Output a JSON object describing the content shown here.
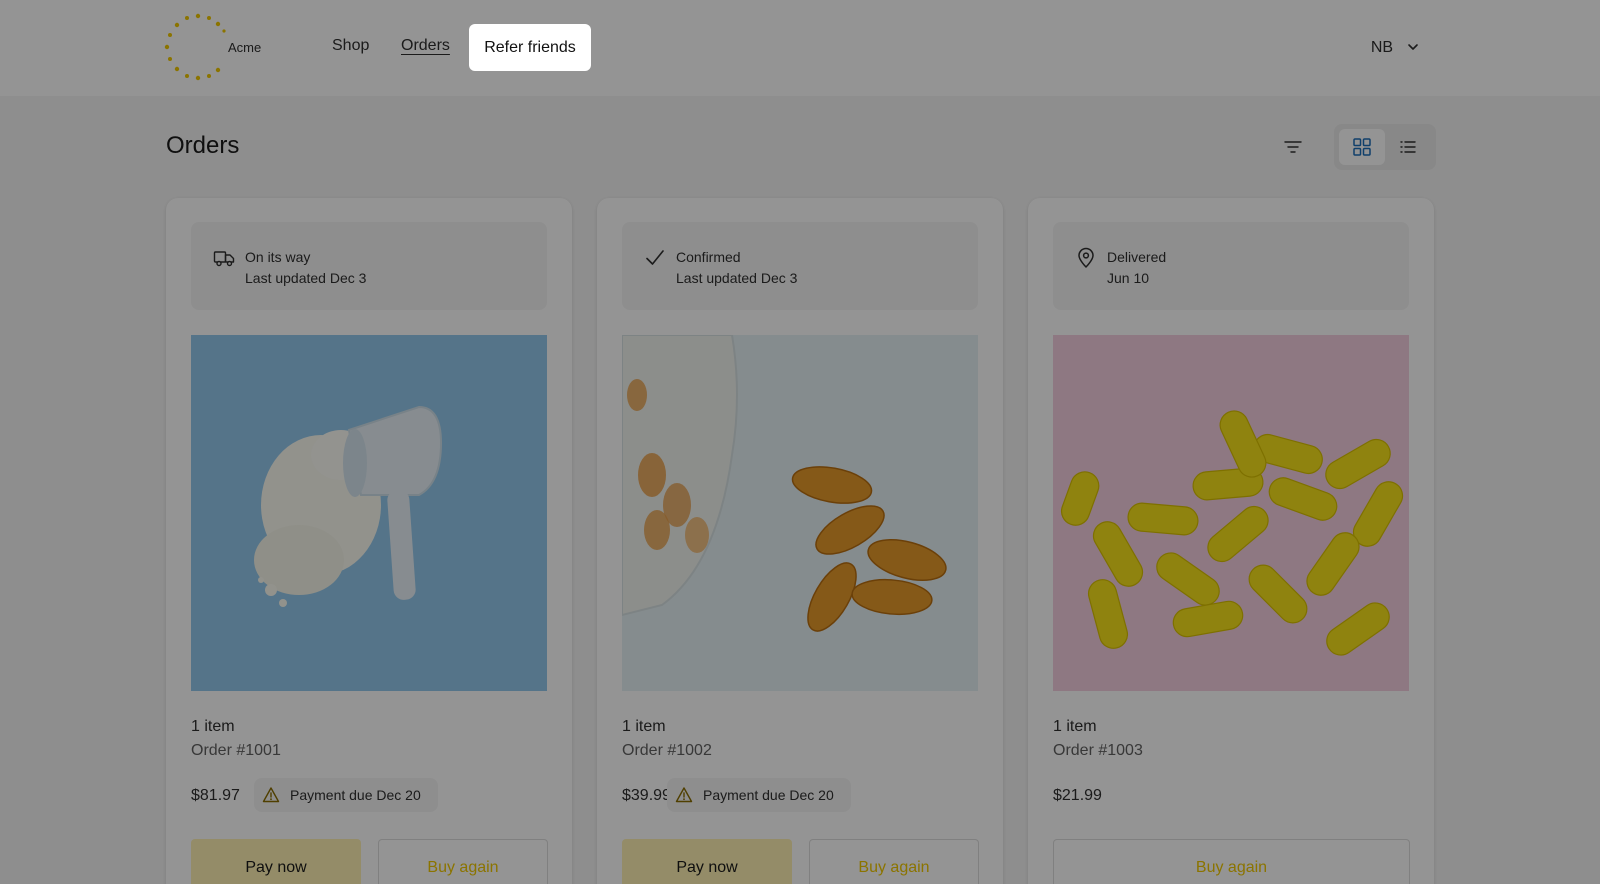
{
  "app": {
    "logo_text": "Acme"
  },
  "nav": {
    "shop": "Shop",
    "orders": "Orders",
    "refer": "Refer friends"
  },
  "user": {
    "initials": "NB"
  },
  "page": {
    "title": "Orders"
  },
  "colors": {
    "accent_yellow": "#f0c800",
    "pay_button": "#fff2b3",
    "overlay": "rgba(0,0,0,0.42)"
  },
  "orders": [
    {
      "status_icon": "truck-icon",
      "status": "On its way",
      "status_detail": "Last updated Dec 3",
      "item_count": "1 item",
      "order_number": "Order #1001",
      "price": "$81.97",
      "payment_due": "Payment due Dec 20",
      "pay_label": "Pay now",
      "buy_again_label": "Buy again"
    },
    {
      "status_icon": "check-icon",
      "status": "Confirmed",
      "status_detail": "Last updated Dec 3",
      "item_count": "1 item",
      "order_number": "Order #1002",
      "price": "$39.99",
      "payment_due": "Payment due Dec 20",
      "pay_label": "Pay now",
      "buy_again_label": "Buy again"
    },
    {
      "status_icon": "location-pin-icon",
      "status": "Delivered",
      "status_detail": "Jun 10",
      "item_count": "1 item",
      "order_number": "Order #1003",
      "price": "$21.99",
      "buy_again_label": "Buy again"
    }
  ]
}
